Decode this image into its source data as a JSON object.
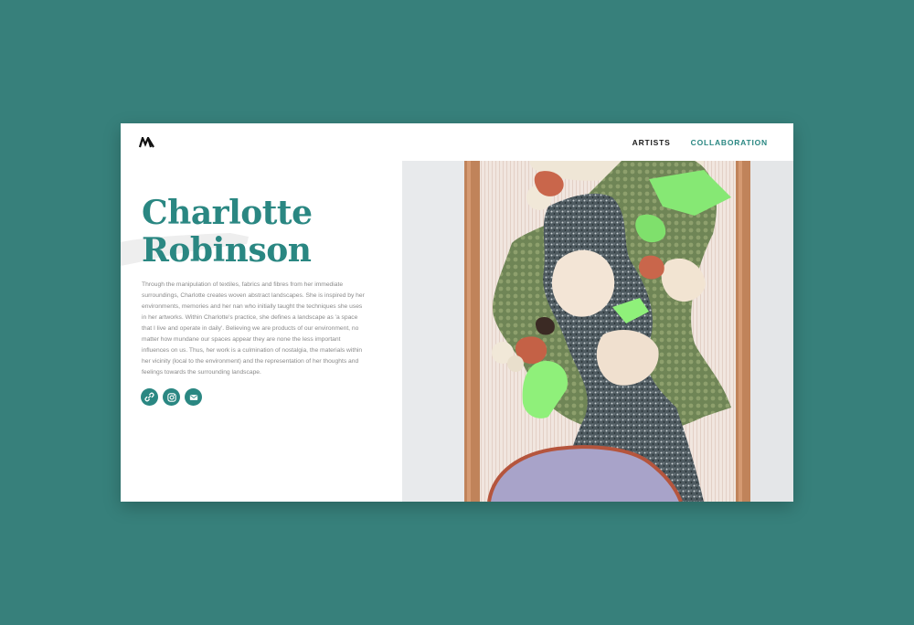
{
  "nav": {
    "items": [
      {
        "label": "ARTISTS",
        "active": false
      },
      {
        "label": "COLLABORATION",
        "active": true
      }
    ]
  },
  "artist": {
    "first_name": "Charlotte",
    "last_name": "Robinson",
    "bio": "Through the manipulation of textiles, fabrics and fibres from her immediate surroundings, Charlotte creates woven abstract landscapes. She is inspired by her environments, memories and her nan who initially taught the techniques she uses in her artworks. Within Charlotte's practice, she defines a landscape as 'a space that I live and operate in daily'. Believing we are products of our environment, no matter how mundane our spaces appear they are none the less important influences on us. Thus, her work is a culmination of nostalgia, the materials within her vicinity (local to the environment) and the representation of her thoughts and feelings towards the surrounding landscape."
  },
  "socials": [
    {
      "icon": "link-icon"
    },
    {
      "icon": "instagram-icon"
    },
    {
      "icon": "email-icon"
    }
  ],
  "colors": {
    "background": "#37807b",
    "accent": "#2a8782",
    "text": "#8a8a8a"
  }
}
